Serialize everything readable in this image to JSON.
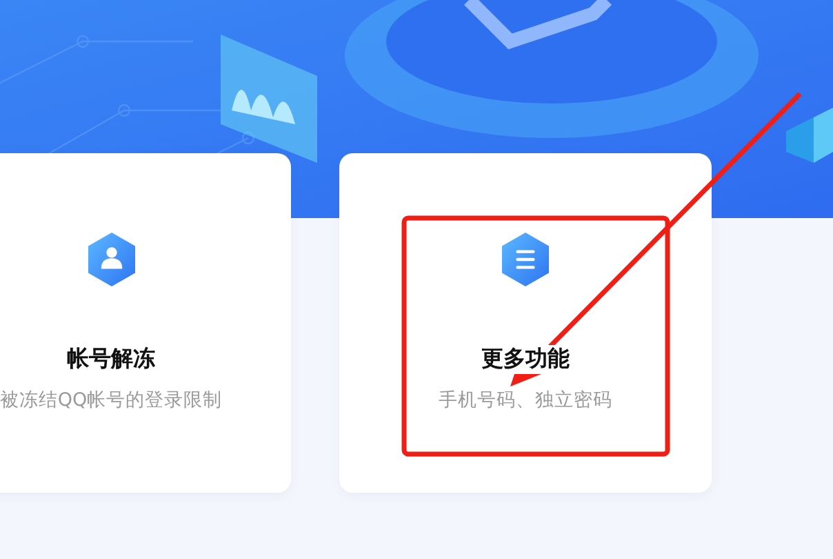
{
  "cards": [
    {
      "kind": "user",
      "title": "帐号解冻",
      "subtitle": "被冻结QQ帐号的登录限制"
    },
    {
      "kind": "menu",
      "title": "更多功能",
      "subtitle": "手机号码、独立密码"
    }
  ]
}
